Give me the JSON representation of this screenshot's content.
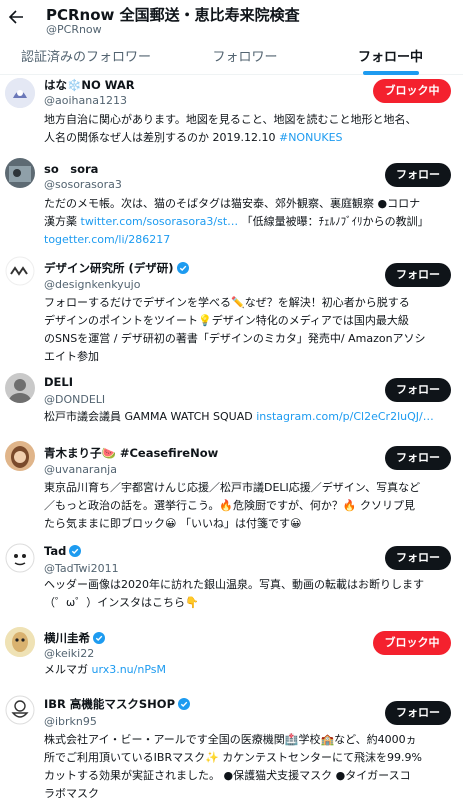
{
  "header": {
    "back_icon": "arrow-left-icon",
    "title": "PCRnow 全国郵送・恵比寿来院検査",
    "handle": "@PCRnow"
  },
  "tabs": [
    {
      "label": "認証済みのフォロワー",
      "active": false
    },
    {
      "label": "フォロワー",
      "active": false
    },
    {
      "label": "フォロー中",
      "active": true
    }
  ],
  "colors": {
    "accent": "#1d9bf0",
    "block": "#f4212e",
    "follow": "#0f1419",
    "verified": "#1d9bf0"
  },
  "users": [
    {
      "name": "はな❄️NO WAR",
      "handle": "@aoihana1213",
      "verified": false,
      "button": "ブロック中",
      "button_type": "block",
      "bio": [
        "地方自治に関心があります。地図を見ること、地図を読むこと地形と地名、",
        "人名の関係なぜ人は差別するのか 2019.12.10 ",
        "#NONUKES"
      ]
    },
    {
      "name": "so　sora",
      "handle": "@sosorasora3",
      "verified": false,
      "button": "フォロー",
      "button_type": "follow",
      "bio": [
        "ただのメモ帳。次は、猫のそばタグは猫安泰、郊外観察、裏庭観察 ●コロナ",
        "漢方薬 ",
        "twitter.com/sosorasora3/st…",
        " 「低線量被曝：ﾁｪﾙﾉﾌﾞｲﾘからの教訓」",
        "togetter.com/li/286217"
      ]
    },
    {
      "name": "デザイン研究所 (デザ研)",
      "handle": "@designkenkyujo",
      "verified": true,
      "button": "フォロー",
      "button_type": "follow",
      "bio": [
        "フォローするだけでデザインを学べる✏️なぜ？を解決！初心者から脱する",
        "デザインのポイントをツイート💡デザイン特化のメディアでは国内最大級",
        "のSNSを運営 / デザ研初の著書「デザインのミカタ」発売中/ Amazonアソシ",
        "エイト参加"
      ]
    },
    {
      "name": "DELI",
      "handle": "@DONDELI",
      "verified": false,
      "button": "フォロー",
      "button_type": "follow",
      "bio": [
        "松戸市議会議員 GAMMA WATCH SQUAD ",
        "instagram.com/p/Cl2eCr2luQJ/…"
      ]
    },
    {
      "name": "青木まり子🍉 #CeasefireNow",
      "handle": "@uvanaranja",
      "verified": false,
      "button": "フォロー",
      "button_type": "follow",
      "bio": [
        "東京品川育ち／宇都宮けんじ応援／松戸市議DELI応援／デザイン、写真など",
        "／もっと政治の話を。選挙行こう。🔥危険厨ですが、何か？🔥 クソリプ見",
        "たら気ままに即ブロック😀 「いいね」は付箋です😀"
      ]
    },
    {
      "name": "Tad",
      "handle": "@TadTwi2011",
      "verified": true,
      "button": "フォロー",
      "button_type": "follow",
      "bio": [
        "ヘッダー画像は2020年に訪れた銀山温泉。写真、動画の転載はお断りします",
        "（゜ω゜）インスタはこちら👇"
      ]
    },
    {
      "name": "横川圭希",
      "handle": "@keiki22",
      "verified": true,
      "button": "ブロック中",
      "button_type": "block",
      "bio": [
        "メルマガ ",
        "urx3.nu/nPsM"
      ]
    },
    {
      "name": "IBR 高機能マスクSHOP",
      "handle": "@ibrkn95",
      "verified": true,
      "button": "フォロー",
      "button_type": "follow",
      "bio": [
        "株式会社アイ・ビー・アールです全国の医療機関🏥学校🏫など、約4000ヵ",
        "所でご利用頂いているIBRマスク✨ カケンテストセンターにて飛沫を99.9%",
        "カットする効果が実証されました。 ●保護猫犬支援マスク ●タイガースコ",
        "ラボマスク"
      ]
    }
  ]
}
